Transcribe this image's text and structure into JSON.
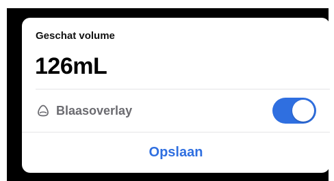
{
  "card": {
    "title": "Geschat volume",
    "volume": "126mL"
  },
  "overlay": {
    "label": "Blaasoverlay",
    "icon": "bladder-outline-icon",
    "enabled": true
  },
  "actions": {
    "save_label": "Opslaan"
  },
  "colors": {
    "accent": "#2f6fe0",
    "label_gray": "#6b6b70",
    "backdrop": "#000000"
  }
}
